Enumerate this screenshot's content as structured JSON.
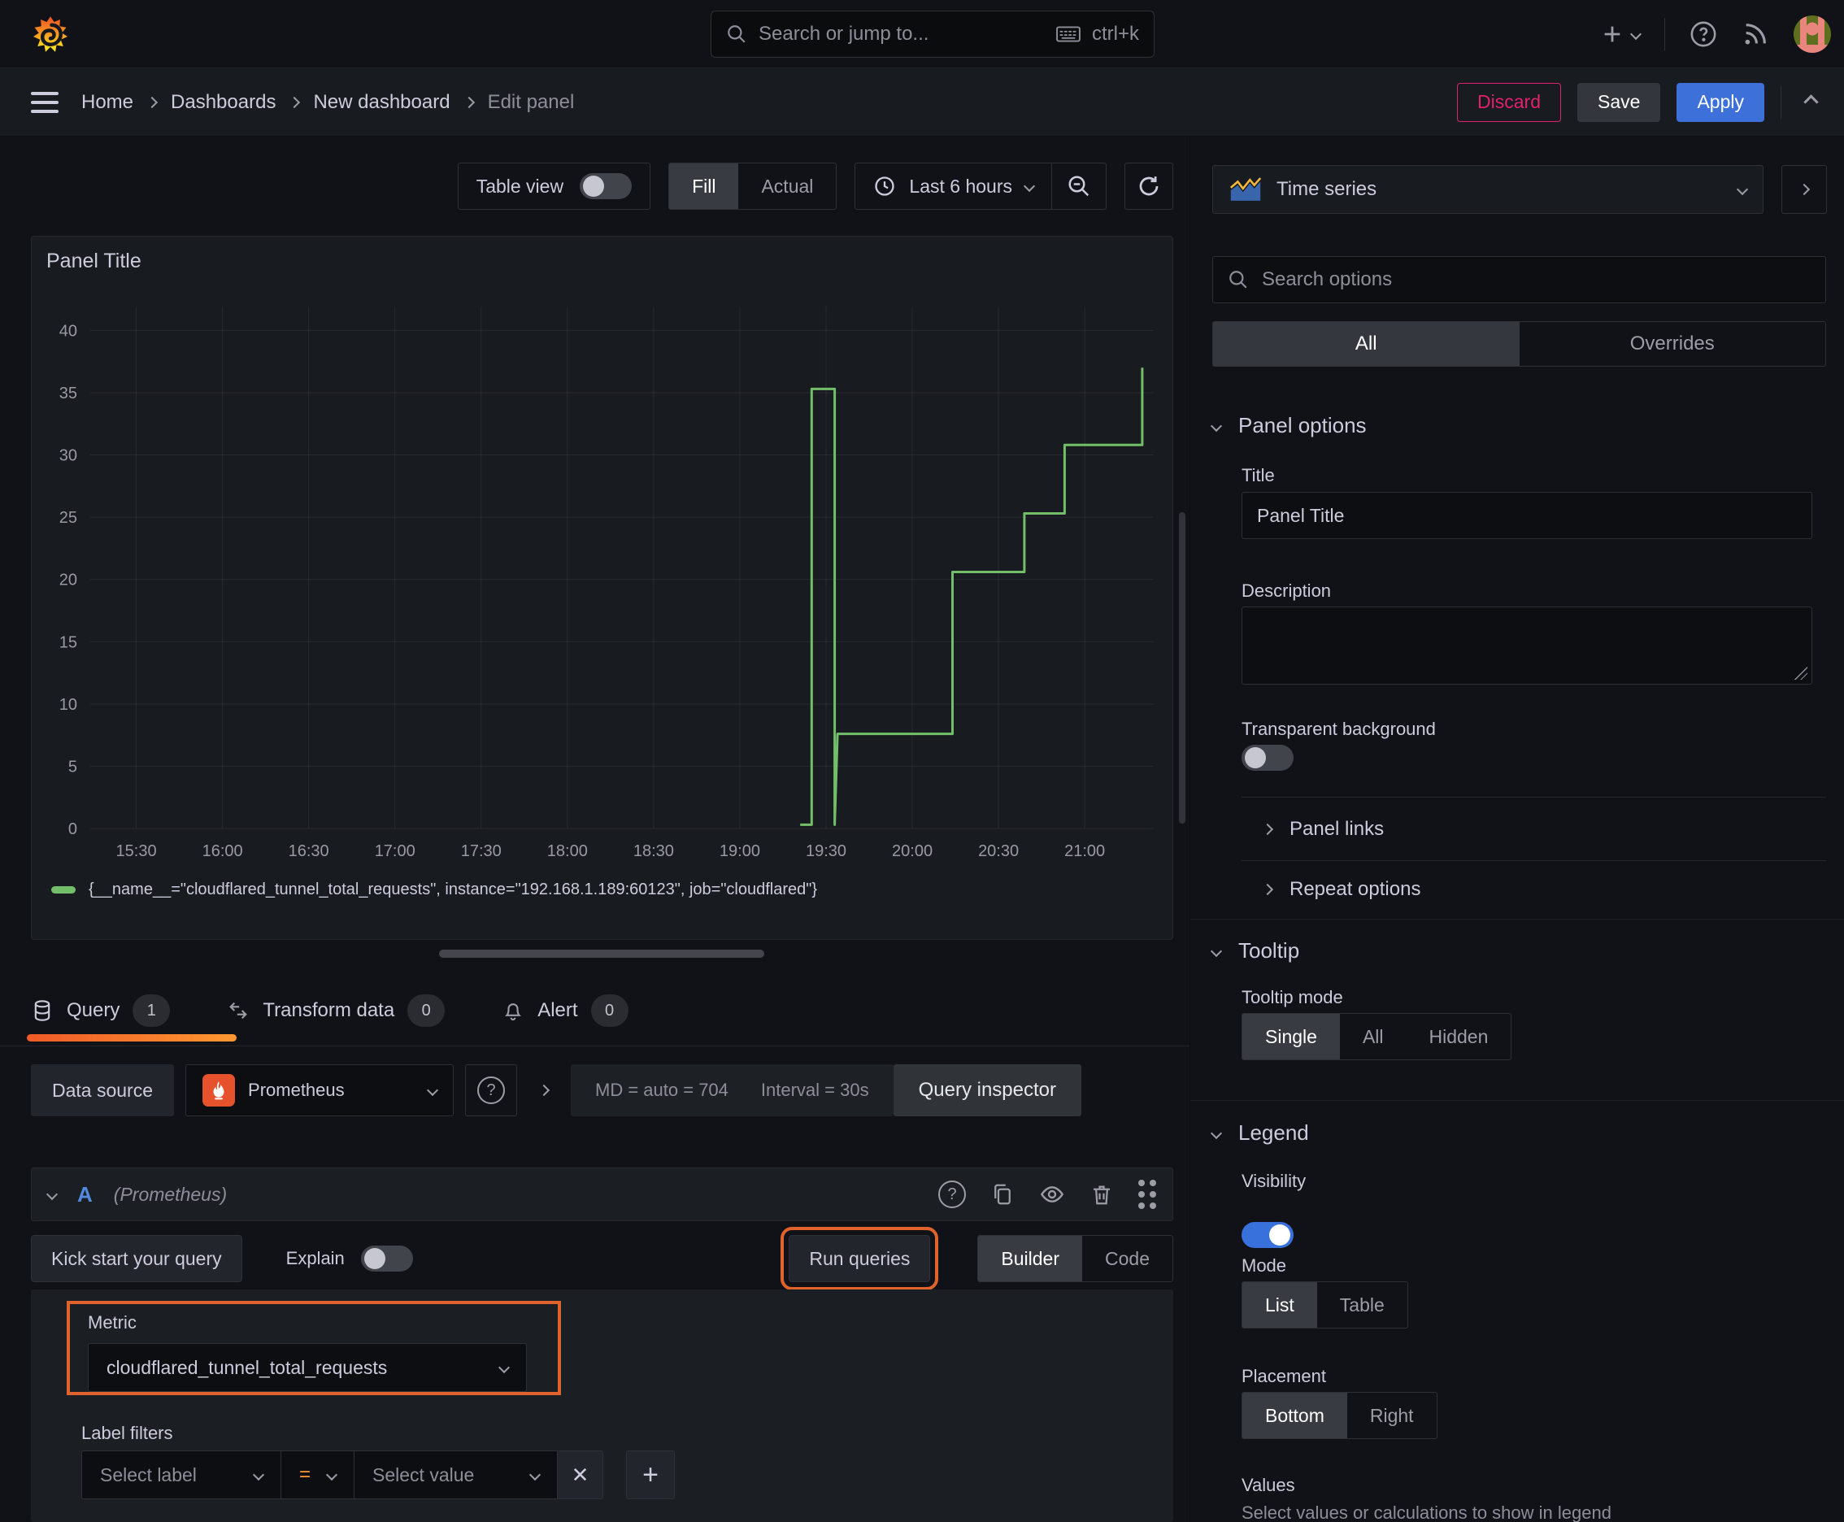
{
  "topnav": {
    "search_placeholder": "Search or jump to...",
    "search_shortcut": "ctrl+k"
  },
  "breadcrumb": {
    "items": [
      "Home",
      "Dashboards",
      "New dashboard",
      "Edit panel"
    ],
    "discard_label": "Discard",
    "save_label": "Save",
    "apply_label": "Apply"
  },
  "toolbar": {
    "table_view_label": "Table view",
    "fill_label": "Fill",
    "actual_label": "Actual",
    "time_range_label": "Last 6 hours"
  },
  "panel": {
    "title": "Panel Title",
    "legend_series": "{__name__=\"cloudflared_tunnel_total_requests\", instance=\"192.168.1.189:60123\", job=\"cloudflared\"}"
  },
  "chart_data": {
    "type": "line",
    "title": "Panel Title",
    "x_range": [
      "15:14",
      "21:24"
    ],
    "x_ticks": [
      "15:30",
      "16:00",
      "16:30",
      "17:00",
      "17:30",
      "18:00",
      "18:30",
      "19:00",
      "19:30",
      "20:00",
      "20:30",
      "21:00"
    ],
    "ylim": [
      0,
      40
    ],
    "y_ticks": [
      0,
      5,
      10,
      15,
      20,
      25,
      30,
      35,
      40
    ],
    "grid": true,
    "legend_position": "bottom",
    "series": [
      {
        "name": "{__name__=\"cloudflared_tunnel_total_requests\", instance=\"192.168.1.189:60123\", job=\"cloudflared\"}",
        "color": "#73bf69",
        "points": [
          [
            "19:21",
            0.3
          ],
          [
            "19:25",
            0.3
          ],
          [
            "19:25",
            35.3
          ],
          [
            "19:33",
            35.3
          ],
          [
            "19:33",
            0.3
          ],
          [
            "19:34",
            7.6
          ],
          [
            "20:14",
            7.6
          ],
          [
            "20:14",
            20.6
          ],
          [
            "20:39",
            20.6
          ],
          [
            "20:39",
            25.3
          ],
          [
            "20:53",
            25.3
          ],
          [
            "20:53",
            30.8
          ],
          [
            "21:20",
            30.8
          ],
          [
            "21:20",
            37.0
          ]
        ]
      }
    ]
  },
  "tabs": {
    "query_label": "Query",
    "query_count": "1",
    "transform_label": "Transform data",
    "transform_count": "0",
    "alert_label": "Alert",
    "alert_count": "0"
  },
  "datasource_bar": {
    "label": "Data source",
    "selected": "Prometheus",
    "stat_md": "MD = auto = 704",
    "stat_interval": "Interval = 30s",
    "inspector_label": "Query inspector"
  },
  "query_row": {
    "ref_id": "A",
    "datasource_hint": "(Prometheus)",
    "kickstart_label": "Kick start your query",
    "explain_label": "Explain",
    "run_label": "Run queries",
    "builder_label": "Builder",
    "code_label": "Code",
    "metric": {
      "label": "Metric",
      "value": "cloudflared_tunnel_total_requests"
    },
    "label_filters": {
      "label": "Label filters",
      "select_label_placeholder": "Select label",
      "operator": "=",
      "select_value_placeholder": "Select value"
    }
  },
  "sidebar": {
    "visualization": "Time series",
    "search_placeholder": "Search options",
    "tab_all": "All",
    "tab_overrides": "Overrides",
    "panel_options": {
      "heading": "Panel options",
      "title_label": "Title",
      "title_value": "Panel Title",
      "description_label": "Description",
      "transparent_label": "Transparent background",
      "panel_links": "Panel links",
      "repeat_options": "Repeat options"
    },
    "tooltip": {
      "heading": "Tooltip",
      "mode_label": "Tooltip mode",
      "options": [
        "Single",
        "All",
        "Hidden"
      ],
      "selected": "Single"
    },
    "legend": {
      "heading": "Legend",
      "visibility_label": "Visibility",
      "mode_label": "Mode",
      "mode_options": [
        "List",
        "Table"
      ],
      "mode_selected": "List",
      "placement_label": "Placement",
      "placement_options": [
        "Bottom",
        "Right"
      ],
      "placement_selected": "Bottom",
      "values_label": "Values",
      "values_description": "Select values or calculations to show in legend"
    }
  },
  "colors": {
    "accent_orange": "#e0632e",
    "tab_underline_from": "#f05a28",
    "tab_underline_to": "#ff9830",
    "series_green": "#73bf69",
    "apply_blue": "#3d71d9",
    "discard_pink": "#e0226e",
    "toggle_on_blue": "#3871dc",
    "prometheus_orange": "#e6522c"
  }
}
